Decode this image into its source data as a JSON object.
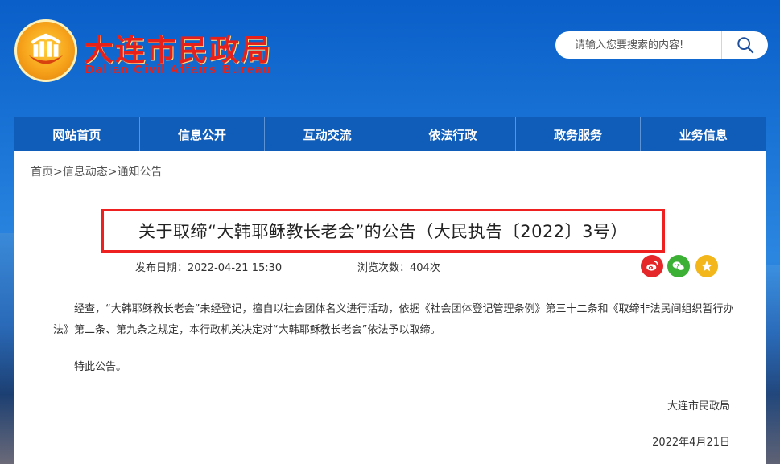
{
  "header": {
    "title": "大连市民政局",
    "subtitle": "Dalian Civil Affairs Bureau",
    "search": {
      "placeholder": "请输入您要搜索的内容!"
    }
  },
  "nav": {
    "items": [
      {
        "label": "网站首页"
      },
      {
        "label": "信息公开"
      },
      {
        "label": "互动交流"
      },
      {
        "label": "依法行政"
      },
      {
        "label": "政务服务"
      },
      {
        "label": "业务信息"
      }
    ]
  },
  "breadcrumb": {
    "home": "首页",
    "sep1": ">",
    "section": "信息动态",
    "sep2": ">",
    "current": "通知公告"
  },
  "article": {
    "title": "关于取缔“大韩耶稣教长老会”的公告（大民执告〔2022〕3号）",
    "publish_label": "发布日期：",
    "publish_date": "2022-04-21  15:30",
    "views_label": "浏览次数：",
    "views": "404次",
    "paragraph1": "经查，“大韩耶稣教长老会”未经登记，擅自以社会团体名义进行活动，依据《社会团体登记管理条例》第三十二条和《取缔非法民间组织暂行办法》第二条、第九条之规定，本行政机关决定对“大韩耶稣教长老会”依法予以取缔。",
    "paragraph2": "特此公告。",
    "signer": "大连市民政局",
    "sign_date": "2022年4月21日"
  },
  "share": {
    "weibo_color": "#e6272a",
    "wechat_color": "#3cb034",
    "favorite_color": "#f3b71c"
  }
}
